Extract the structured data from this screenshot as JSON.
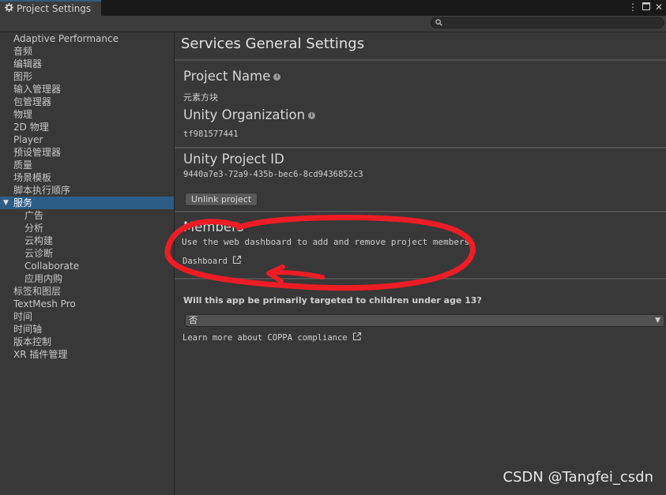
{
  "window": {
    "tab_title": "Project Settings",
    "icons": [
      "gear-icon",
      "kebab-menu-icon",
      "maximize-icon",
      "close-icon"
    ]
  },
  "search": {
    "placeholder": "",
    "icon": "search-icon"
  },
  "sidebar": {
    "items": [
      {
        "label": "Adaptive Performance"
      },
      {
        "label": "音频"
      },
      {
        "label": "编辑器"
      },
      {
        "label": "图形"
      },
      {
        "label": "输入管理器"
      },
      {
        "label": "包管理器"
      },
      {
        "label": "物理"
      },
      {
        "label": "2D 物理"
      },
      {
        "label": "Player"
      },
      {
        "label": "预设管理器"
      },
      {
        "label": "质量"
      },
      {
        "label": "场景模板"
      },
      {
        "label": "脚本执行顺序"
      },
      {
        "label": "服务",
        "selected": true
      },
      {
        "label": "广告",
        "sub": true
      },
      {
        "label": "分析",
        "sub": true
      },
      {
        "label": "云构建",
        "sub": true
      },
      {
        "label": "云诊断",
        "sub": true
      },
      {
        "label": "Collaborate",
        "sub": true
      },
      {
        "label": "应用内购",
        "sub": true
      },
      {
        "label": "标签和图层"
      },
      {
        "label": "TextMesh Pro"
      },
      {
        "label": "时间"
      },
      {
        "label": "时间轴"
      },
      {
        "label": "版本控制"
      },
      {
        "label": "XR 插件管理"
      }
    ]
  },
  "main": {
    "title": "Services General Settings",
    "project_name_label": "Project Name",
    "project_name_value": "元素方块",
    "org_label": "Unity Organization",
    "org_value": "tf981577441",
    "project_id_label": "Unity Project ID",
    "project_id_value": "9440a7e3-72a9-435b-bec6-8cd9436852c3",
    "unlink_button": "Unlink project",
    "members_label": "Members",
    "members_desc": "Use the web dashboard to add and remove project members.",
    "dashboard_link": "Dashboard",
    "coppa_question": "Will this app be primarily targeted to children under age 13?",
    "coppa_selected": "否",
    "coppa_link": "Learn more about COPPA compliance"
  },
  "watermark": "CSDN @Tangfei_csdn",
  "colors": {
    "selection": "#2c5d87",
    "annotation": "#ee1c24",
    "background": "#383838"
  }
}
